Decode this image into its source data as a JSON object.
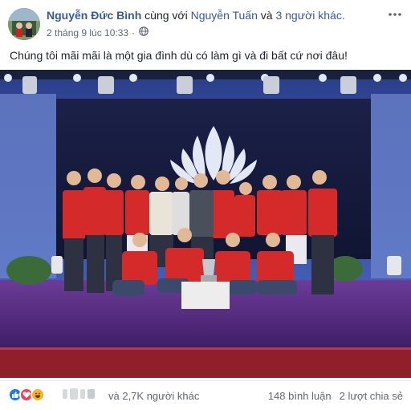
{
  "post": {
    "author": "Nguyễn Đức Bình",
    "with_text": "cùng với",
    "tagged": "Nguyễn Tuấn",
    "and_text": "và",
    "others": "3 người khác.",
    "timestamp": "2 tháng 9 lúc 10:33",
    "separator": "·",
    "privacy_icon": "globe-icon",
    "caption": "Chúng tôi mãi mãi là một gia đình dù có làm gì và đi bất cứ nơi đâu!"
  },
  "footer": {
    "reaction_icons": [
      "like-icon",
      "love-icon",
      "haha-icon"
    ],
    "reaction_summary": "và 2,7K người khác",
    "comments": "148 bình luận",
    "shares": "2 lượt chia sẻ"
  },
  "colors": {
    "link": "#385898",
    "meta": "#616770",
    "like": "#1877f2",
    "love": "#f33e58",
    "haha": "#f7b125",
    "stage_floor": "#5b2f86",
    "jersey_red": "#d42a2a"
  }
}
